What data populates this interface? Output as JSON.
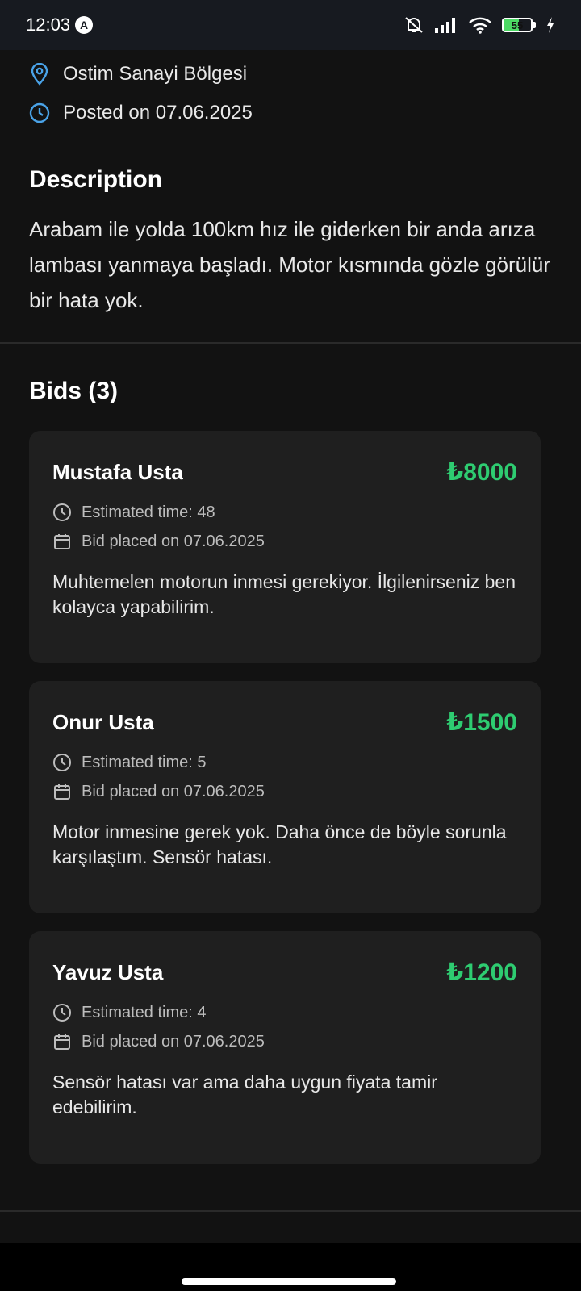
{
  "status_bar": {
    "time": "12:03",
    "nav_badge": "A",
    "battery": "55",
    "battery_level": 0.55
  },
  "job": {
    "location": "Ostim Sanayi Bölgesi",
    "posted": "Posted on 07.06.2025",
    "description_title": "Description",
    "description": "Arabam ile yolda 100km hız ile giderken bir anda arıza lambası yanmaya başladı. Motor kısmında gözle görülür bir hata yok."
  },
  "bids": {
    "title": "Bids (3)",
    "items": [
      {
        "name": "Mustafa Usta",
        "amount": "₺8000",
        "estimated": "Estimated time: 48",
        "placed": "Bid placed on 07.06.2025",
        "message": "Muhtemelen motorun inmesi gerekiyor. İlgilenirseniz ben kolayca yapabilirim."
      },
      {
        "name": "Onur Usta",
        "amount": "₺1500",
        "estimated": "Estimated time: 5",
        "placed": "Bid placed on 07.06.2025",
        "message": "Motor inmesine gerek yok. Daha önce de böyle sorunla karşılaştım. Sensör hatası."
      },
      {
        "name": "Yavuz Usta",
        "amount": "₺1200",
        "estimated": "Estimated time: 4",
        "placed": "Bid placed on 07.06.2025",
        "message": "Sensör hatası var ama daha uygun fiyata tamir edebilirim."
      }
    ]
  },
  "colors": {
    "accent_blue": "#4aa3e8",
    "price_green": "#2ecc71",
    "card_bg": "#1f1f1f",
    "page_bg": "#121212"
  },
  "icons": [
    "mute-icon",
    "signal-icon",
    "wifi-icon",
    "battery-icon",
    "charging-icon",
    "location-pin-icon",
    "clock-icon",
    "calendar-icon"
  ]
}
